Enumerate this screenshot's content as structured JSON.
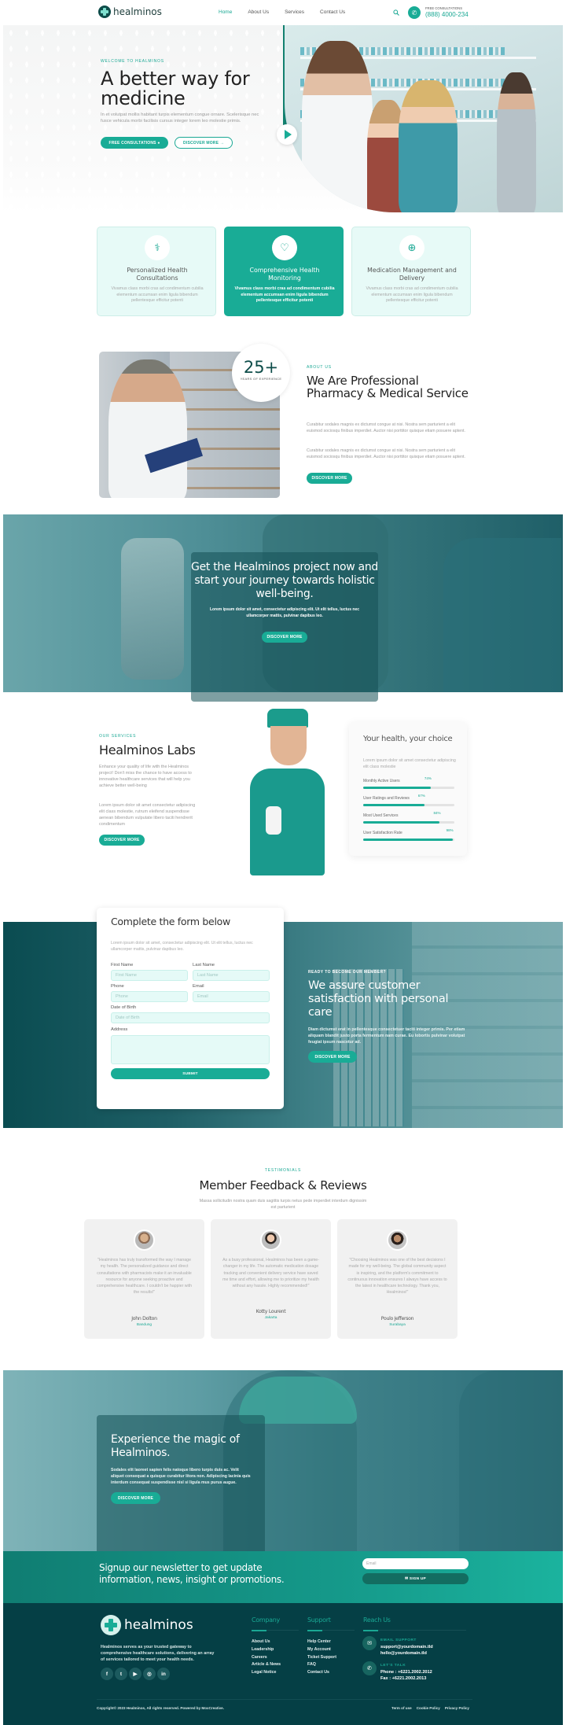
{
  "brand": {
    "name": "healminos",
    "accent": "#19ac96",
    "dark": "#053f45"
  },
  "header": {
    "nav": [
      {
        "label": "Home",
        "active": true
      },
      {
        "label": "About Us",
        "active": false
      },
      {
        "label": "Services",
        "active": false
      },
      {
        "label": "Contact Us",
        "active": false
      }
    ],
    "search_icon": "search-icon",
    "phone_icon": "phone-icon",
    "consult_label": "FREE CONSULTATIONS",
    "consult_phone": "(888) 4000-234"
  },
  "hero": {
    "kicker": "WELCOME TO HEALMINOS",
    "title": "A better way for medicine",
    "description": "In et volutpat mollis habitant turpis elementum congue ornare. Scelerisque nec fusce vehicula morbi facilisis cursus integer lorem leo molestie primis.",
    "primary_button": "FREE CONSULTATIONS",
    "secondary_button": "DISCOVER MORE",
    "play_icon": "play-icon"
  },
  "features": [
    {
      "icon": "doctor-icon",
      "title": "Personalized Health Consultations",
      "description": "Vivamus class morbi cras ad condimentum cubilia elementum accumsan enim ligula bibendum pellentesque efficitur potenti",
      "active": false
    },
    {
      "icon": "heartbeat-icon",
      "title": "Comprehensive Health Monitoring",
      "description": "Vivamus class morbi cras ad condimentum cubilia elementum accumsan enim ligula bibendum pellentesque efficitur potenti",
      "active": true
    },
    {
      "icon": "medicine-icon",
      "title": "Medication Management and Delivery",
      "description": "Vivamus class morbi cras ad condimentum cubilia elementum accumsan enim ligula bibendum pellentesque efficitur potenti",
      "active": false
    }
  ],
  "about": {
    "badge_number": "25+",
    "badge_label": "YEARS OF EXPERIENCE",
    "kicker": "ABOUT US",
    "title": "We Are Professional Pharmacy & Medical Service",
    "paragraph1": "Curabitur sodales magnis ex dictumst congue at nisi. Nostra sem parturient a elit euismod sociosqu finibus imperdiet. Auctor nisi porttitor quisque etiam posuere aptent.",
    "paragraph2": "Curabitur sodales magnis ex dictumst congue at nisi. Nostra sem parturient a elit euismod sociosqu finibus imperdiet. Auctor nisi porttitor quisque etiam posuere aptent.",
    "button": "DISCOVER MORE"
  },
  "cta_banner": {
    "title": "Get the Healminos project now and start your journey towards holistic well-being.",
    "description": "Lorem ipsum dolor sit amet, consectetur adipiscing elit. Ut elit tellus, luctus nec ullamcorper mattis, pulvinar dapibus leo.",
    "button": "DISCOVER MORE"
  },
  "labs": {
    "kicker": "OUR SERVICES",
    "title": "Healminos Labs",
    "paragraph1": "Enhance your quality of life with the Healminos project! Don't miss the chance to have access to innovative healthcare services that will help you achieve better well-being",
    "paragraph2": "Lorem ipsum dolor sit amet consectetur adipiscing elit class molestie, rutrum eleifend suspendisse aenean bibendum vulputate libero taciti hendrerit condimentum",
    "button": "DISCOVER MORE",
    "stats_card": {
      "title": "Your health, your choice",
      "description": "Lorem ipsum dolor sit amet consectetur adipiscing elit class molestie",
      "stats": [
        {
          "label": "Monthly Active Users",
          "percent": 74,
          "display": "74%"
        },
        {
          "label": "User Ratings and Reviews",
          "percent": 67,
          "display": "67%"
        },
        {
          "label": "Most Used Services",
          "percent": 84,
          "display": "84%"
        },
        {
          "label": "User Satisfaction Rate",
          "percent": 98,
          "display": "98%"
        }
      ]
    }
  },
  "form": {
    "title": "Complete the form below",
    "description": "Lorem ipsum dolor sit amet, consectetur adipiscing elit. Ut elit tellus, luctus nec ullamcorper mattis, pulvinar dapibus leo.",
    "fields": {
      "first_name": {
        "label": "First Name",
        "placeholder": "First Name"
      },
      "last_name": {
        "label": "Last Name",
        "placeholder": "Last Name"
      },
      "phone": {
        "label": "Phone",
        "placeholder": "Phone"
      },
      "email": {
        "label": "Email",
        "placeholder": "Email"
      },
      "dob": {
        "label": "Date of Birth",
        "placeholder": "Date of Birth"
      },
      "address": {
        "label": "Address",
        "placeholder": ""
      }
    },
    "submit": "SUBMIT"
  },
  "member": {
    "kicker": "READY TO BECOME OUR MEMBER?",
    "title": "We assure customer satisfaction with personal care",
    "description": "Diam dictumst erat in pellentesque consectetuer taciti integer primis. Per etiam aliquam blandit justo porta fermentum nam curae. Eu lobortis pulvinar volutpat feugiat ipsum nascetur ad.",
    "button": "DISCOVER MORE"
  },
  "testimonials": {
    "kicker": "TESTIMONIALS",
    "title": "Member Feedback & Reviews",
    "subtitle": "Massa sollicitudin nostra quam duis sagittis turpis netus pede imperdiet interdum dignissim est parturient",
    "items": [
      {
        "quote": "\"Healminos has truly transformed the way I manage my health. The personalized guidance and direct consultations with pharmacists make it an invaluable resource for anyone seeking proactive and comprehensive healthcare. I couldn't be happier with the results!\"",
        "name": "John Dolton",
        "city": "Bandung"
      },
      {
        "quote": "As a busy professional, Healminos has been a game-changer in my life. The automatic medication dosage tracking and convenient delivery service have saved me time and effort, allowing me to prioritize my health without any hassle. Highly recommended!\"",
        "name": "Kotty Lourent",
        "city": "Jakarta"
      },
      {
        "quote": "\"Choosing Healminos was one of the best decisions I made for my well-being. The global community aspect is inspiring, and the platform's commitment to continuous innovation ensures I always have access to the latest in healthcare technology. Thank you, Healminos!\"",
        "name": "Poulo Jefferson",
        "city": "Surabaya"
      }
    ]
  },
  "experience": {
    "title": "Experience the magic of Healminos.",
    "description": "Sodales elit laoreet sapien felis natoque libero turpis duis ac. Velit aliquet consequat a quisque curabitur litora non. Adipiscing lacinia quis interdum consequat suspendisse nisl si ligula mus purus augue.",
    "button": "DISCOVER MORE"
  },
  "newsletter": {
    "text": "Signup our newsletter to get update information, news, insight or promotions.",
    "email_placeholder": "Email",
    "button": "✉ SIGN UP"
  },
  "footer": {
    "about": "Healminos serves as your trusted gateway to comprehensive healthcare solutions, delivering an array of services tailored to meet your health needs.",
    "socials": [
      "facebook-icon",
      "twitter-icon",
      "youtube-icon",
      "instagram-icon",
      "linkedin-icon"
    ],
    "company": {
      "title": "Company",
      "links": [
        "About Us",
        "Leadership",
        "Careers",
        "Article & News",
        "Legal Notice"
      ]
    },
    "support": {
      "title": "Support",
      "links": [
        "Help Center",
        "My Account",
        "Ticket Support",
        "FAQ",
        "Contact Us"
      ]
    },
    "reach": {
      "title": "Reach Us",
      "email_label": "EMAIL SUPPORT",
      "email1": "support@yourdomain.tld",
      "email2": "hello@yourdomain.tld",
      "talk_label": "LET'S TALK",
      "phone": "Phone : +6221.2002.2012",
      "fax": "Fax : +6221.2002.2013"
    },
    "copyright": "Copyright© 2023 Healminos, All rights reserved. Powered by MoxCreative.",
    "legal": [
      "Term of use",
      "Cookie Policy",
      "Privacy Policy"
    ]
  }
}
